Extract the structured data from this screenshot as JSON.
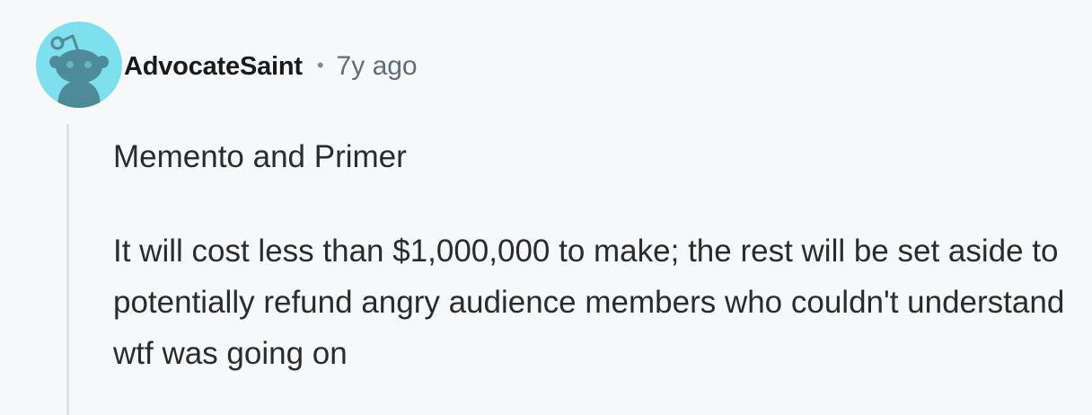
{
  "comment": {
    "author": "AdvocateSaint",
    "separator": "•",
    "timestamp": "7y ago",
    "avatar_icon": "snoo-avatar-icon",
    "paragraphs": [
      "Memento and Primer",
      "It will cost less than $1,000,000 to make; the rest will be set aside to potentially refund angry audience members who couldn't understand wtf was going on"
    ]
  },
  "colors": {
    "background": "#f7f8fa",
    "avatar_bg": "#7ee0ec",
    "snoo": "#4e8a98",
    "thread_line": "#dfe3e8",
    "text": "#1a1a1b",
    "meta": "#5d6d7e"
  }
}
